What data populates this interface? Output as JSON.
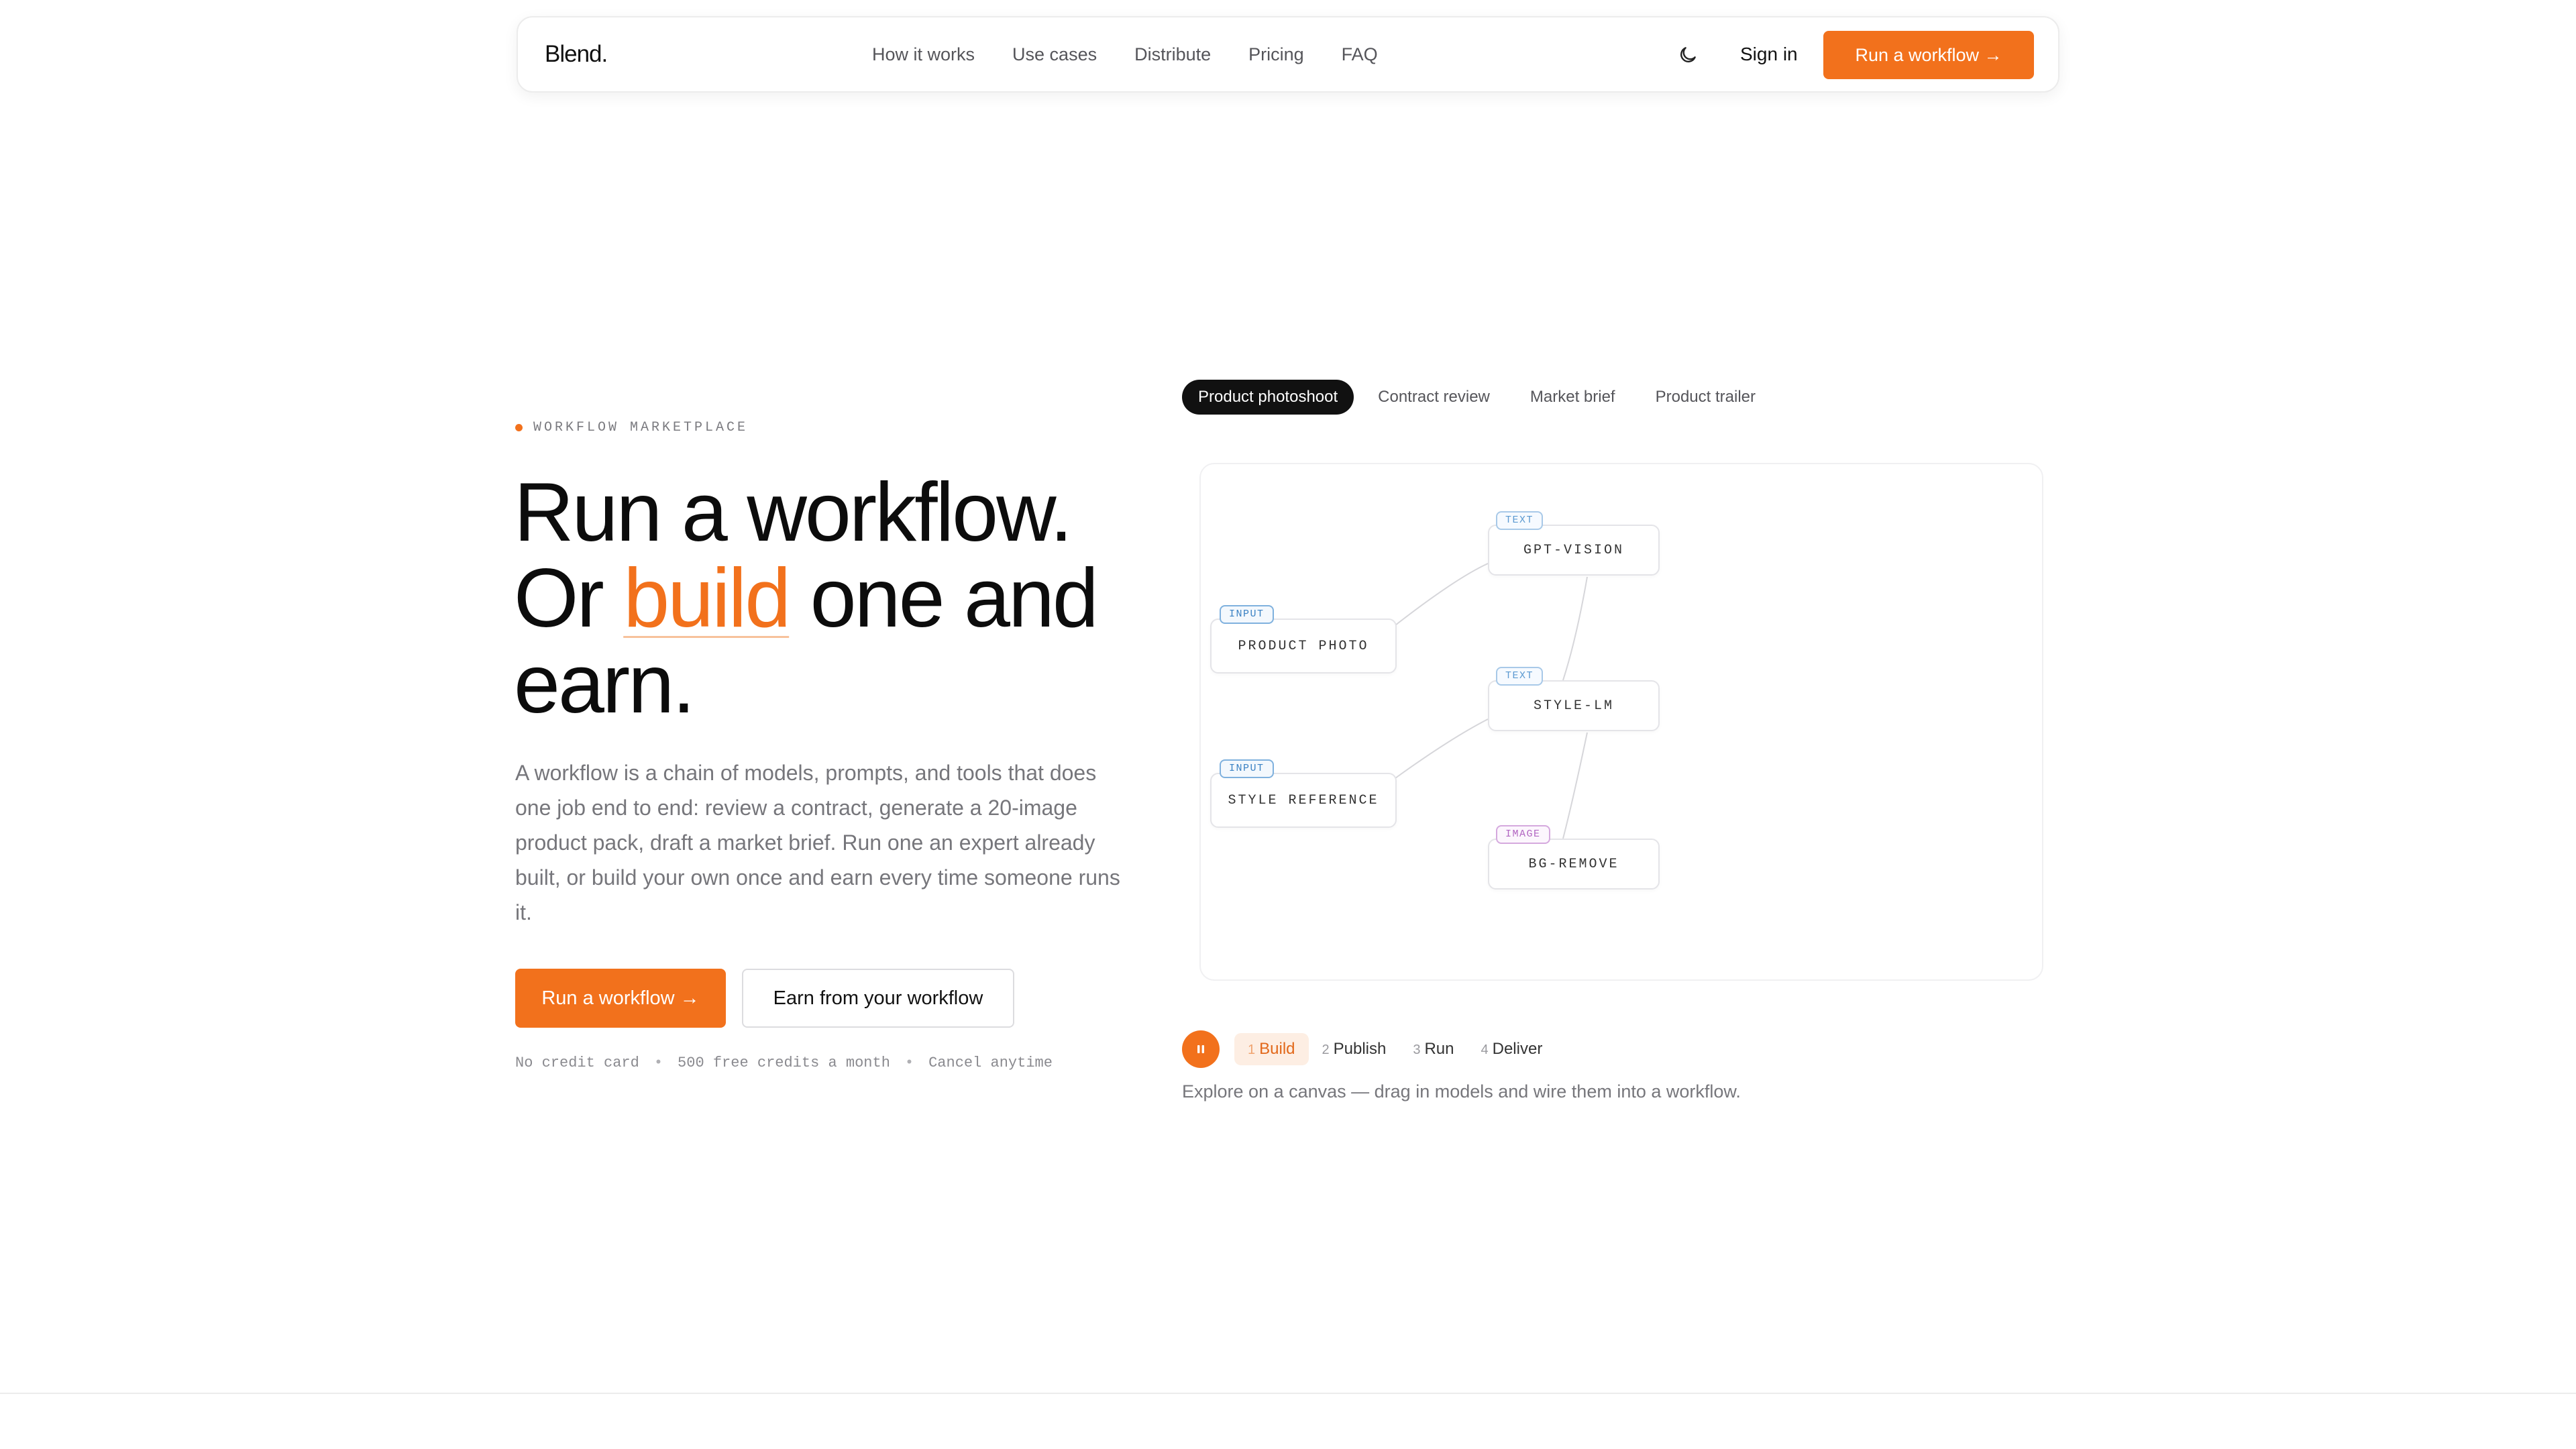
{
  "nav": {
    "logo": "Blend.",
    "links": [
      "How it works",
      "Use cases",
      "Distribute",
      "Pricing",
      "FAQ"
    ],
    "theme_icon": "moon-icon",
    "signin": "Sign in",
    "cta": "Run a workflow →"
  },
  "hero": {
    "eyebrow": "WORKFLOW MARKETPLACE",
    "headline_1": "Run a workflow.",
    "headline_2a": "Or ",
    "headline_accent": "build",
    "headline_2b": " one and",
    "headline_3": "earn.",
    "lead": "A workflow is a chain of models, prompts, and tools that does one job end to end: review a contract, generate a 20-image product pack, draft a market brief. Run one an expert already built, or build your own once and earn every time someone runs it.",
    "primary_cta": "Run a workflow →",
    "secondary_cta": "Earn from your workflow",
    "fineprint": [
      "No credit card",
      "500 free credits a month",
      "Cancel anytime"
    ],
    "fineprint_sep": "•"
  },
  "demo": {
    "tabs": [
      "Product photoshoot",
      "Contract review",
      "Market brief",
      "Product trailer"
    ],
    "active_tab": 0,
    "nodes": {
      "gpt_vision": {
        "label": "GPT-VISION",
        "tag": "TEXT"
      },
      "product_photo": {
        "label": "PRODUCT PHOTO",
        "tag": "INPUT"
      },
      "style_lm": {
        "label": "STYLE-LM",
        "tag": "TEXT"
      },
      "style_reference": {
        "label": "STYLE REFERENCE",
        "tag": "INPUT"
      },
      "bg_remove": {
        "label": "BG-REMOVE",
        "tag": "IMAGE"
      }
    },
    "pause_icon": "pause-icon",
    "steps": [
      {
        "num": "1",
        "label": "Build"
      },
      {
        "num": "2",
        "label": "Publish"
      },
      {
        "num": "3",
        "label": "Run"
      },
      {
        "num": "4",
        "label": "Deliver"
      }
    ],
    "active_step": 0,
    "caption": "Explore on a canvas — drag in models and wire them into a workflow."
  },
  "colors": {
    "accent": "#f2711c",
    "text": "#111111",
    "muted": "#76767b",
    "tag_input": "#3b82c4",
    "tag_text": "#5c9ad1",
    "tag_image": "#b266c2"
  }
}
